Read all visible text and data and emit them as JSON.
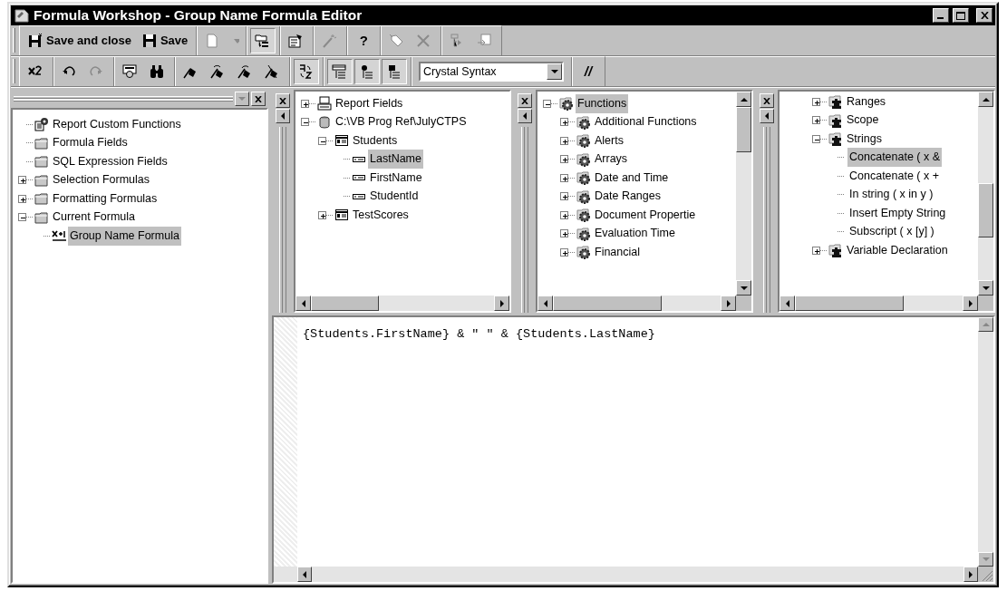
{
  "window": {
    "title": "Formula Workshop - Group Name Formula Editor"
  },
  "toolbars": [
    {
      "groups": [
        [
          {
            "kind": "button",
            "label": "Save and close",
            "disabled": false,
            "pressed": false
          },
          {
            "kind": "button",
            "label": "Save",
            "disabled": false,
            "pressed": false
          }
        ],
        [
          {
            "kind": "button",
            "disabled": true,
            "pressed": false
          },
          {
            "kind": "dropdown",
            "disabled": true,
            "pressed": false
          }
        ],
        [
          {
            "kind": "button",
            "disabled": false,
            "pressed": true
          }
        ],
        [
          {
            "kind": "button",
            "disabled": false,
            "pressed": false
          }
        ],
        [
          {
            "kind": "button",
            "disabled": true,
            "pressed": false
          }
        ],
        [
          {
            "kind": "text",
            "label": "?",
            "disabled": false,
            "pressed": false
          }
        ],
        [
          {
            "kind": "button",
            "disabled": true,
            "pressed": false
          },
          {
            "kind": "button",
            "disabled": true,
            "pressed": false
          }
        ],
        [
          {
            "kind": "button",
            "disabled": true,
            "pressed": false
          },
          {
            "kind": "button",
            "disabled": true,
            "pressed": false
          }
        ]
      ]
    },
    {
      "groups": [
        [
          {
            "kind": "button",
            "disabled": false,
            "pressed": false
          }
        ],
        [
          {
            "kind": "button",
            "disabled": false,
            "pressed": false
          },
          {
            "kind": "button",
            "disabled": true,
            "pressed": false
          }
        ],
        [
          {
            "kind": "button",
            "disabled": false,
            "pressed": false
          },
          {
            "kind": "button",
            "disabled": false,
            "pressed": false
          }
        ],
        [
          {
            "kind": "button",
            "disabled": false,
            "pressed": false
          },
          {
            "kind": "button",
            "disabled": false,
            "pressed": false
          },
          {
            "kind": "button",
            "disabled": false,
            "pressed": false
          },
          {
            "kind": "button",
            "disabled": false,
            "pressed": false
          }
        ],
        [
          {
            "kind": "button",
            "disabled": false,
            "pressed": true
          }
        ],
        [
          {
            "kind": "button",
            "disabled": false,
            "pressed": true
          },
          {
            "kind": "button",
            "disabled": false,
            "pressed": true
          },
          {
            "kind": "button",
            "disabled": false,
            "pressed": true
          }
        ],
        [
          {
            "kind": "combo",
            "value": "Crystal Syntax"
          }
        ],
        [
          {
            "kind": "text",
            "label": "//",
            "disabled": false,
            "pressed": false
          }
        ]
      ]
    }
  ],
  "panes": [
    {
      "nodes": [
        {
          "kind": "custom-functions",
          "label": "Report Custom Functions",
          "selected": false
        },
        {
          "kind": "folder",
          "label": "Formula Fields",
          "selected": false
        },
        {
          "kind": "folder",
          "label": "SQL Expression Fields",
          "selected": false
        },
        {
          "kind": "folder",
          "label": "Selection Formulas",
          "expanded": false,
          "selected": false
        },
        {
          "kind": "folder",
          "label": "Formatting Formulas",
          "expanded": false,
          "selected": false
        },
        {
          "kind": "folder",
          "label": "Current Formula",
          "expanded": true,
          "selected": false,
          "children": [
            {
              "kind": "formula",
              "label": "Group Name Formula",
              "selected": true
            }
          ]
        }
      ]
    },
    {
      "nodes": [
        {
          "kind": "report-fields",
          "label": "Report Fields",
          "expanded": false,
          "selected": false
        },
        {
          "kind": "database",
          "label": "C:\\VB Prog Ref\\JulyCTPS",
          "expanded": true,
          "selected": false,
          "children": [
            {
              "kind": "table",
              "label": "Students",
              "expanded": true,
              "selected": false,
              "children": [
                {
                  "kind": "field",
                  "label": "LastName",
                  "selected": true
                },
                {
                  "kind": "field",
                  "label": "FirstName",
                  "selected": false
                },
                {
                  "kind": "field",
                  "label": "StudentId",
                  "selected": false
                }
              ]
            },
            {
              "kind": "table",
              "label": "TestScores",
              "expanded": false,
              "selected": false
            }
          ]
        }
      ]
    },
    {
      "nodes": [
        {
          "kind": "function-folder",
          "label": "Functions",
          "expanded": true,
          "selected": true,
          "children": [
            {
              "kind": "function-category",
              "label": "Additional Functions",
              "expanded": false,
              "selected": false
            },
            {
              "kind": "function-category",
              "label": "Alerts",
              "expanded": false,
              "selected": false
            },
            {
              "kind": "function-category",
              "label": "Arrays",
              "expanded": false,
              "selected": false
            },
            {
              "kind": "function-category",
              "label": "Date and Time",
              "expanded": false,
              "selected": false
            },
            {
              "kind": "function-category",
              "label": "Date Ranges",
              "expanded": false,
              "selected": false
            },
            {
              "kind": "function-category",
              "label": "Document Propertie",
              "expanded": false,
              "selected": false
            },
            {
              "kind": "function-category",
              "label": "Evaluation Time",
              "expanded": false,
              "selected": false
            },
            {
              "kind": "function-category",
              "label": "Financial",
              "expanded": false,
              "selected": false
            }
          ]
        }
      ]
    },
    {
      "nodes": [
        {
          "kind": "operator-category",
          "label": "Ranges",
          "expanded": false,
          "selected": false
        },
        {
          "kind": "operator-category",
          "label": "Scope",
          "expanded": false,
          "selected": false
        },
        {
          "kind": "operator-category",
          "label": "Strings",
          "expanded": true,
          "selected": false,
          "children": [
            {
              "kind": "operator",
              "label": "Concatenate ( x &",
              "selected": true
            },
            {
              "kind": "operator",
              "label": "Concatenate ( x +",
              "selected": false
            },
            {
              "kind": "operator",
              "label": "In string ( x in y )",
              "selected": false
            },
            {
              "kind": "operator",
              "label": "Insert Empty String",
              "selected": false
            },
            {
              "kind": "operator",
              "label": "Subscript ( x [y] )",
              "selected": false
            }
          ]
        },
        {
          "kind": "operator-category",
          "label": "Variable Declaration",
          "expanded": false,
          "selected": false
        }
      ]
    }
  ],
  "editor": {
    "text": "{Students.FirstName} & \" \" & {Students.LastName}"
  }
}
